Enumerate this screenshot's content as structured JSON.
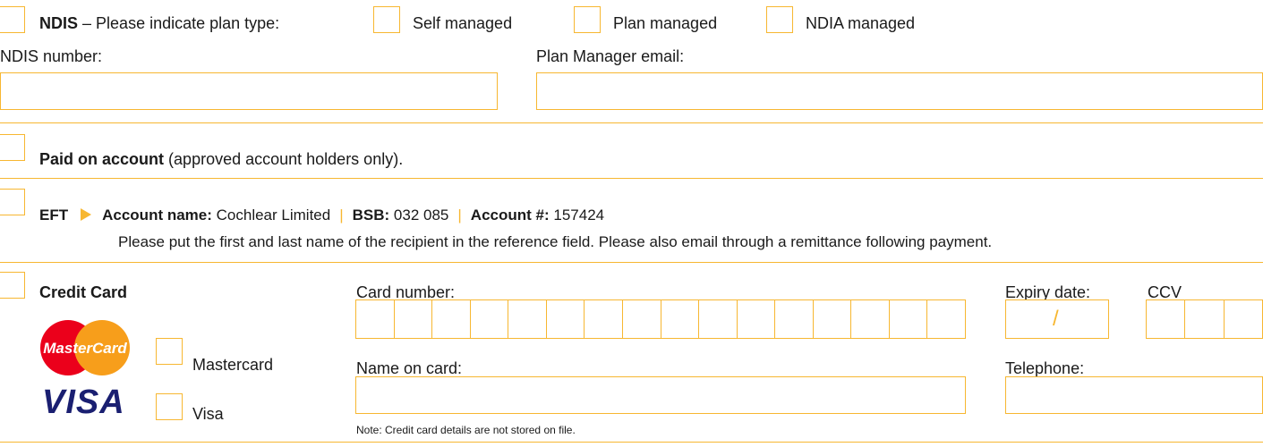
{
  "ndis": {
    "label_bold": "NDIS",
    "label_rest": "– Please indicate plan type:",
    "options": [
      "Self managed",
      "Plan managed",
      "NDIA managed"
    ],
    "number_label": "NDIS number:",
    "email_label": "Plan Manager email:"
  },
  "account": {
    "label_bold": "Paid on account",
    "label_rest": "(approved account holders only)."
  },
  "eft": {
    "label": "EFT",
    "account_name_label": "Account name:",
    "account_name_value": "Cochlear Limited",
    "bsb_label": "BSB:",
    "bsb_value": "032 085",
    "account_num_label": "Account #:",
    "account_num_value": "157424",
    "note": "Please put the first and last name of the recipient in the reference field. Please also email through a remittance following payment."
  },
  "card": {
    "label": "Credit Card",
    "mastercard_logo": "MasterCard",
    "visa_logo": "VISA",
    "mastercard_label": "Mastercard",
    "visa_label": "Visa",
    "number_label": "Card number:",
    "expiry_label": "Expiry date:",
    "expiry_separator": "/",
    "ccv_label": "CCV",
    "name_label": "Name on card:",
    "telephone_label": "Telephone:",
    "note": "Note: Credit card details are not stored on file."
  },
  "colors": {
    "accent": "#f7b731",
    "visa_blue": "#1a1f71",
    "mc_red": "#eb001b",
    "mc_orange": "#f79e1b"
  }
}
